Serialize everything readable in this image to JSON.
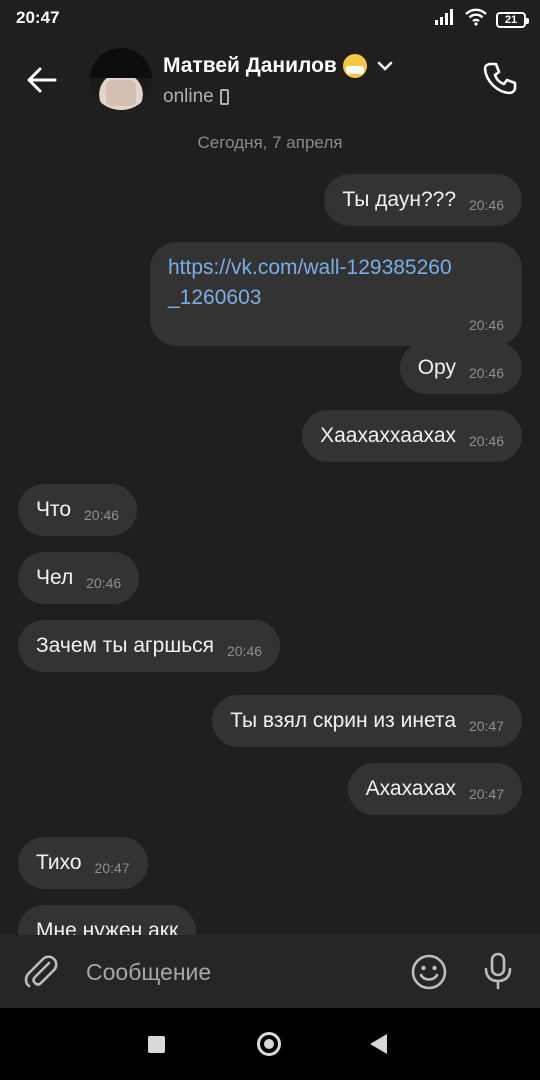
{
  "status_bar": {
    "time": "20:47",
    "battery": "21",
    "icons": [
      "signal-icon",
      "wifi-icon",
      "battery-icon"
    ]
  },
  "header": {
    "contact_name": "Матвей Данилов",
    "contact_emoji": "mask-emoji",
    "status": "online",
    "status_icon": "mobile-phone-icon"
  },
  "chat": {
    "date_label": "Сегодня, 7 апреля",
    "messages": [
      {
        "direction": "out",
        "text": "Ты даун???",
        "time": "20:46"
      },
      {
        "direction": "out",
        "link_line1": "https://vk.com/wall-129385260",
        "link_line2": "_1260603",
        "time": "20:46"
      },
      {
        "direction": "out",
        "text": "Ору",
        "time": "20:46"
      },
      {
        "direction": "out",
        "text": "Хаахаххаахах",
        "time": "20:46"
      },
      {
        "direction": "in",
        "text": "Что",
        "time": "20:46"
      },
      {
        "direction": "in",
        "text": "Чел",
        "time": "20:46"
      },
      {
        "direction": "in",
        "text": "Зачем ты агршься",
        "time": "20:46"
      },
      {
        "direction": "out",
        "text": "Ты взял скрин из инета",
        "time": "20:47"
      },
      {
        "direction": "out",
        "text": "Ахахахах",
        "time": "20:47"
      },
      {
        "direction": "in",
        "text": "Тихо",
        "time": "20:47"
      },
      {
        "direction": "in",
        "text": "Мне нужен акк",
        "time": ""
      }
    ]
  },
  "composer": {
    "placeholder": "Сообщение"
  },
  "colors": {
    "background": "#1f1f1f",
    "bubble": "#333333",
    "link": "#7aaee8",
    "timestamp": "#8f8f8f"
  }
}
